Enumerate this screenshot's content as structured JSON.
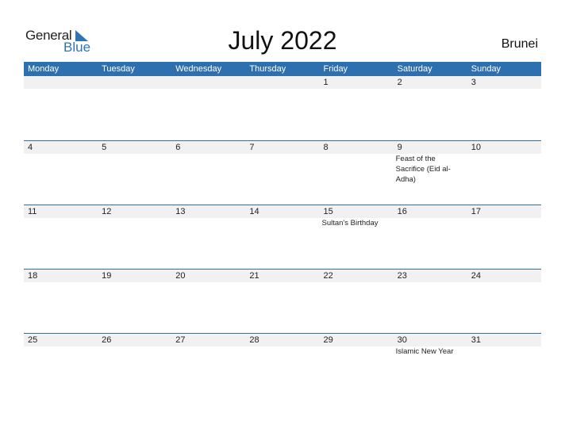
{
  "logo": {
    "line1": "General",
    "line2": "Blue"
  },
  "title": "July 2022",
  "country": "Brunei",
  "colors": {
    "header_bg": "#2e6fb0",
    "date_strip": "#f1f1f1",
    "accent": "#2f74b5"
  },
  "weekdays": [
    "Monday",
    "Tuesday",
    "Wednesday",
    "Thursday",
    "Friday",
    "Saturday",
    "Sunday"
  ],
  "weeks": [
    [
      {
        "d": ""
      },
      {
        "d": ""
      },
      {
        "d": ""
      },
      {
        "d": ""
      },
      {
        "d": "1"
      },
      {
        "d": "2"
      },
      {
        "d": "3"
      }
    ],
    [
      {
        "d": "4"
      },
      {
        "d": "5"
      },
      {
        "d": "6"
      },
      {
        "d": "7"
      },
      {
        "d": "8"
      },
      {
        "d": "9",
        "ev": "Feast of the Sacrifice (Eid al-Adha)"
      },
      {
        "d": "10"
      }
    ],
    [
      {
        "d": "11"
      },
      {
        "d": "12"
      },
      {
        "d": "13"
      },
      {
        "d": "14"
      },
      {
        "d": "15",
        "ev": "Sultan's Birthday"
      },
      {
        "d": "16"
      },
      {
        "d": "17"
      }
    ],
    [
      {
        "d": "18"
      },
      {
        "d": "19"
      },
      {
        "d": "20"
      },
      {
        "d": "21"
      },
      {
        "d": "22"
      },
      {
        "d": "23"
      },
      {
        "d": "24"
      }
    ],
    [
      {
        "d": "25"
      },
      {
        "d": "26"
      },
      {
        "d": "27"
      },
      {
        "d": "28"
      },
      {
        "d": "29"
      },
      {
        "d": "30",
        "ev": "Islamic New Year"
      },
      {
        "d": "31"
      }
    ]
  ]
}
